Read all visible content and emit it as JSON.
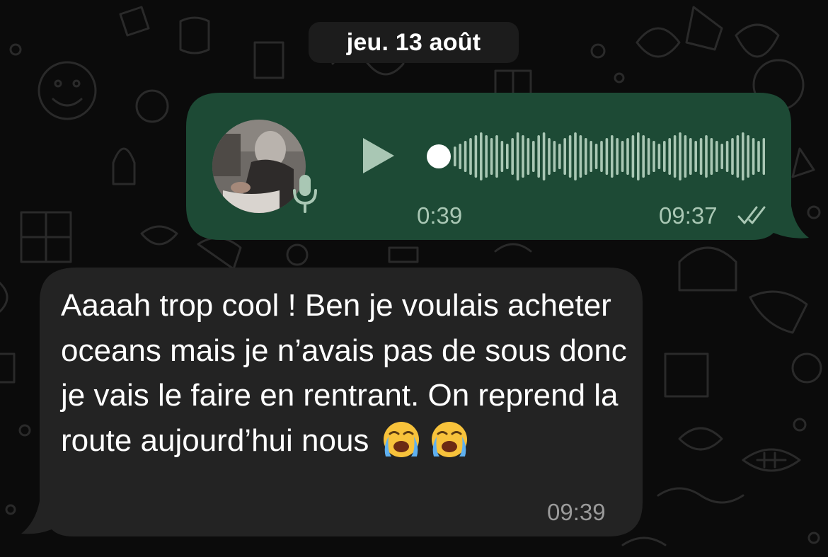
{
  "date_chip": "jeu. 13 août",
  "voice_message": {
    "duration": "0:39",
    "time": "09:37",
    "play_icon": "play-icon",
    "mic_icon": "microphone-icon",
    "status_icon": "double-check-icon",
    "playback_progress": 0
  },
  "text_message": {
    "text": "Aaaah trop cool ! Ben je voulais acheter oceans mais je n’avais pas de sous donc je vais le faire en rentrant. On reprend la route aujourd’hui nous",
    "emojis": [
      "crying-face-icon",
      "crying-face-icon"
    ],
    "time": "09:39"
  },
  "colors": {
    "background": "#0b0b0b",
    "outgoing_bubble": "#1d4a35",
    "incoming_bubble": "#232323",
    "date_chip": "#1c1c1c",
    "meta_outgoing": "#a9c7b4",
    "meta_incoming": "#9a9a9a"
  }
}
